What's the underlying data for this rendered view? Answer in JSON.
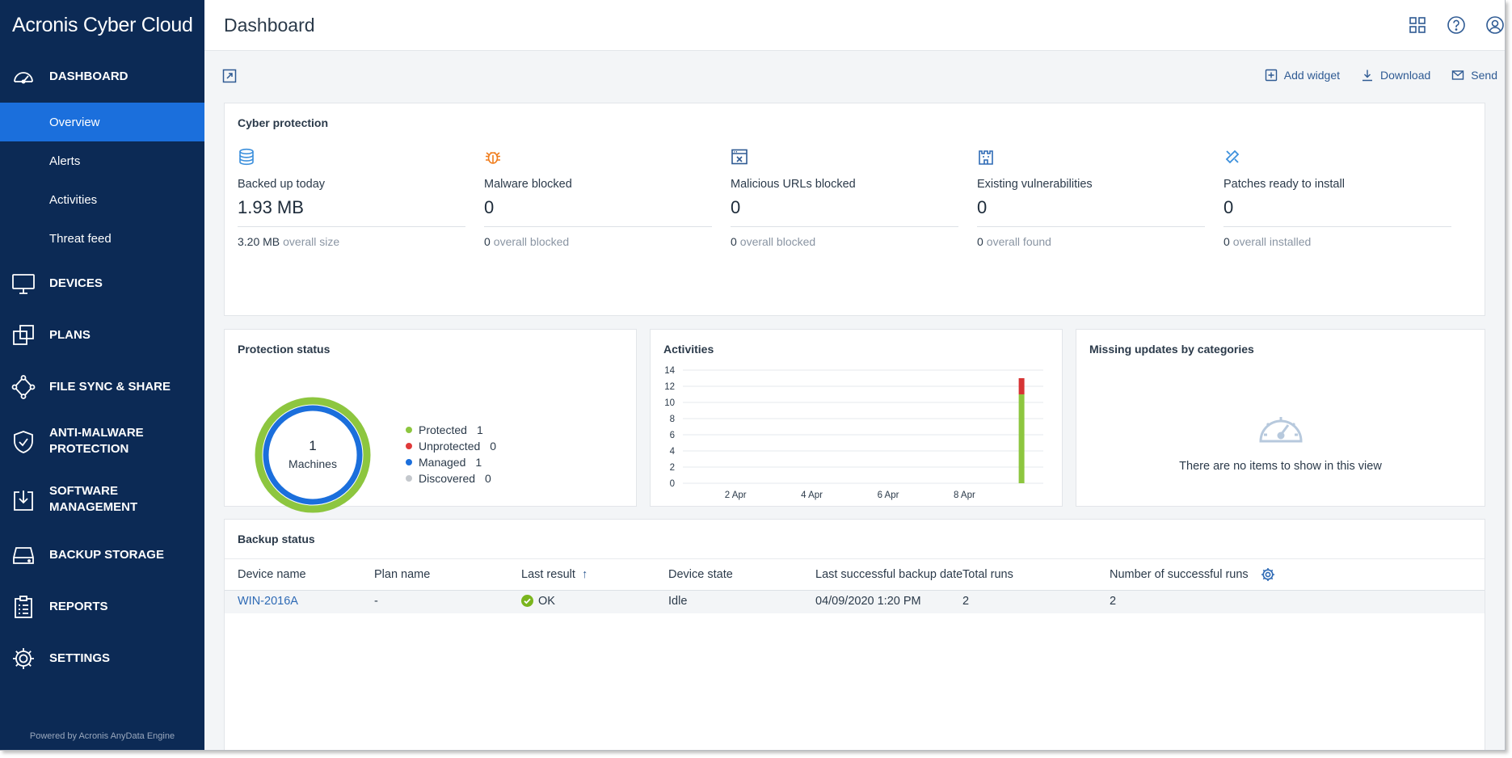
{
  "app": {
    "brand": "Acronis Cyber Cloud",
    "powered_by": "Powered by Acronis AnyData Engine"
  },
  "sidebar": {
    "sections": [
      {
        "id": "dashboard",
        "label": "DASHBOARD",
        "icon": "gauge-icon"
      },
      {
        "id": "devices",
        "label": "DEVICES",
        "icon": "monitor-icon"
      },
      {
        "id": "plans",
        "label": "PLANS",
        "icon": "plans-icon"
      },
      {
        "id": "file-sync",
        "label": "FILE SYNC & SHARE",
        "icon": "share-nodes-icon"
      },
      {
        "id": "anti-malware",
        "label": "ANTI-MALWARE\nPROTECTION",
        "label_line1": "ANTI-MALWARE",
        "label_line2": "PROTECTION",
        "icon": "shield-icon"
      },
      {
        "id": "software",
        "label": "SOFTWARE MANAGEMENT",
        "label_line1": "SOFTWARE",
        "label_line2": "MANAGEMENT",
        "icon": "software-download-icon"
      },
      {
        "id": "backup-storage",
        "label": "BACKUP STORAGE",
        "icon": "storage-drive-icon"
      },
      {
        "id": "reports",
        "label": "REPORTS",
        "icon": "clipboard-icon"
      },
      {
        "id": "settings",
        "label": "SETTINGS",
        "icon": "gear-icon"
      }
    ],
    "dashboard_sub": [
      {
        "label": "Overview",
        "active": true
      },
      {
        "label": "Alerts",
        "active": false
      },
      {
        "label": "Activities",
        "active": false
      },
      {
        "label": "Threat feed",
        "active": false
      }
    ]
  },
  "header": {
    "title": "Dashboard",
    "icons": [
      "apps-grid-icon",
      "help-icon",
      "account-icon"
    ]
  },
  "toolbar": {
    "add_widget": "Add widget",
    "download": "Download",
    "send": "Send"
  },
  "cyber_protection": {
    "title": "Cyber protection",
    "items": [
      {
        "label": "Backed up today",
        "value": "1.93 MB",
        "foot_value": "3.20 MB",
        "foot_label": "overall size",
        "icon": "database-icon",
        "color": "#3b8fdc"
      },
      {
        "label": "Malware blocked",
        "value": "0",
        "foot_value": "0",
        "foot_label": "overall blocked",
        "icon": "bug-icon",
        "color": "#f07c1b"
      },
      {
        "label": "Malicious URLs blocked",
        "value": "0",
        "foot_value": "0",
        "foot_label": "overall blocked",
        "icon": "blocked-url-icon",
        "color": "#2e5a93"
      },
      {
        "label": "Existing vulnerabilities",
        "value": "0",
        "foot_value": "0",
        "foot_label": "overall found",
        "icon": "castle-icon",
        "color": "#2e6ab5"
      },
      {
        "label": "Patches ready to install",
        "value": "0",
        "foot_value": "0",
        "foot_label": "overall installed",
        "icon": "patch-icon",
        "color": "#3b8fdc"
      }
    ]
  },
  "protection_status": {
    "title": "Protection status",
    "total": "1",
    "total_label": "Machines",
    "legend": [
      {
        "label": "Protected",
        "count": "1",
        "color": "#8dc63f"
      },
      {
        "label": "Unprotected",
        "count": "0",
        "color": "#e03a3a"
      },
      {
        "label": "Managed",
        "count": "1",
        "color": "#1b6fdc"
      },
      {
        "label": "Discovered",
        "count": "0",
        "color": "#c4c8cd"
      }
    ]
  },
  "activities": {
    "title": "Activities"
  },
  "chart_data": {
    "type": "bar",
    "title": "Activities",
    "stacked": true,
    "x_tick_labels": [
      "2 Apr",
      "4 Apr",
      "6 Apr",
      "8 Apr"
    ],
    "y_ticks": [
      0,
      2,
      4,
      6,
      8,
      10,
      12,
      14
    ],
    "ylim": [
      0,
      14
    ],
    "grid": true,
    "bars": [
      {
        "date": "9 Apr",
        "segments": [
          {
            "status": "success",
            "value": 11,
            "color": "#8dc63f"
          },
          {
            "status": "failed",
            "value": 2,
            "color": "#d63434"
          }
        ]
      }
    ]
  },
  "missing_updates": {
    "title": "Missing updates by categories",
    "empty_text": "There are no items to show in this view"
  },
  "backup_status": {
    "title": "Backup status",
    "columns": [
      "Device name",
      "Plan name",
      "Last result",
      "Device state",
      "Last successful backup date",
      "Total runs",
      "Number of successful runs"
    ],
    "rows": [
      {
        "device": "WIN-2016A",
        "plan": "-",
        "result": "OK",
        "state": "Idle",
        "last_backup": "04/09/2020 1:20 PM",
        "total_runs": "2",
        "successful_runs": "2"
      }
    ]
  }
}
